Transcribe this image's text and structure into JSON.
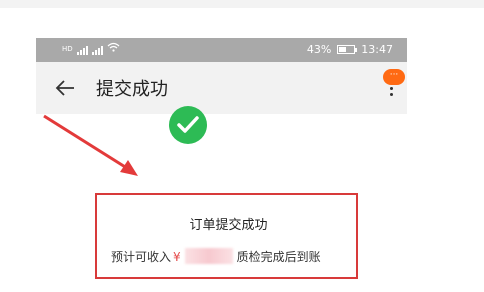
{
  "status_bar": {
    "left_text": "HD",
    "battery_level": "43%",
    "time": "13:47"
  },
  "app_bar": {
    "title": "提交成功",
    "notification_badge": "···"
  },
  "result": {
    "heading": "订单提交成功",
    "income_prefix": "预计可收入",
    "currency": "¥",
    "income_suffix": "质检完成后到账"
  },
  "colors": {
    "success": "#2dbb55",
    "annotation": "#d83a3a",
    "badge": "#ff6a13"
  }
}
